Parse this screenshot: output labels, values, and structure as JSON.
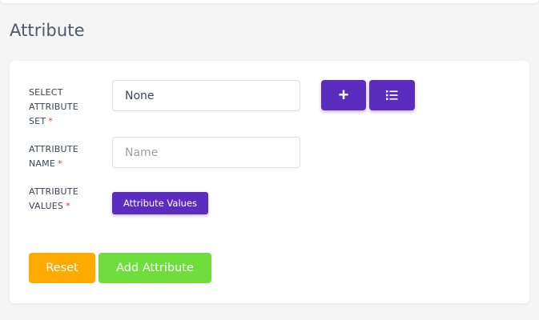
{
  "page": {
    "title": "Attribute"
  },
  "form": {
    "attribute_set": {
      "label": "SELECT\nATTRIBUTE\nSET",
      "required_mark": "*",
      "value": "None",
      "placeholder": ""
    },
    "attribute_name": {
      "label": "ATTRIBUTE\nNAME",
      "required_mark": "*",
      "value": "",
      "placeholder": "Name"
    },
    "attribute_values": {
      "label": "ATTRIBUTE\nVALUES",
      "required_mark": "*",
      "button_label": "Attribute Values"
    },
    "buttons": {
      "add_set_icon": "plus-icon",
      "list_sets_icon": "list-icon",
      "reset_label": "Reset",
      "submit_label": "Add Attribute"
    }
  },
  "colors": {
    "primary": "#5b2dbf",
    "reset": "#ffaa00",
    "submit": "#6fde3c",
    "required": "#e53935"
  }
}
